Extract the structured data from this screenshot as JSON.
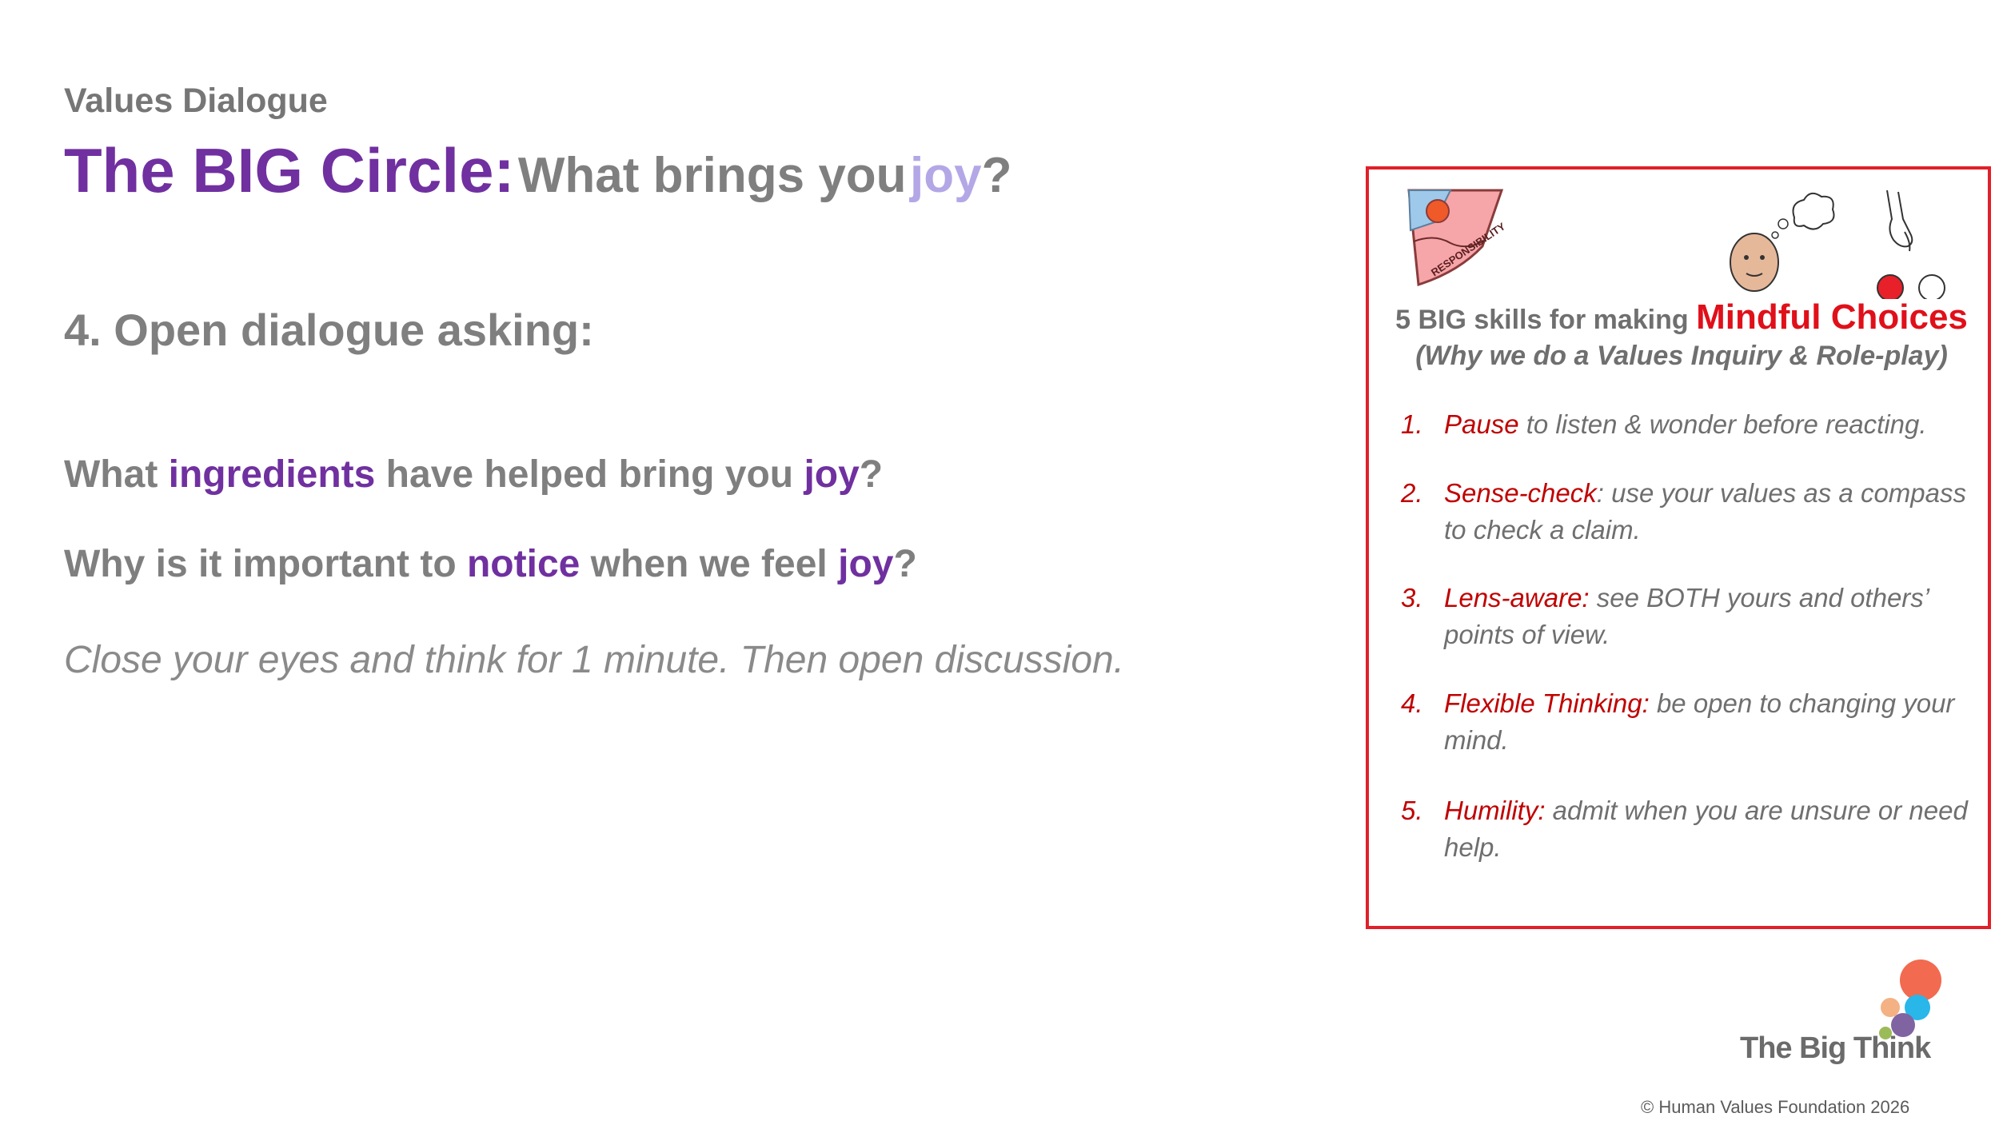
{
  "header": {
    "kicker": "Values Dialogue",
    "title_main": "The BIG Circle:",
    "title_sub": "What brings you",
    "title_joy": "joy",
    "title_q": "?"
  },
  "main": {
    "step": "4. Open dialogue asking:",
    "question1": {
      "a": "What ",
      "b": "ingredients",
      "c": " have helped bring you ",
      "d": "joy",
      "e": "?"
    },
    "question2": {
      "a": "Why is it important to ",
      "b": "notice",
      "c": " when we feel ",
      "d": "joy",
      "e": "?"
    },
    "instruction": "Close your eyes and think for 1 minute. Then open discussion."
  },
  "panel": {
    "heading_a": "5 BIG skills for making ",
    "heading_b": "Mindful Choices",
    "subheading": "(Why we do a Values Inquiry & Role-play)",
    "badge_text": "RESPONSIBILITY",
    "skills": [
      {
        "num": "1.",
        "key": "Pause",
        "text": " to listen & wonder before reacting."
      },
      {
        "num": "2.",
        "key": "Sense-check",
        "text": ": use your values as a compass to check a claim."
      },
      {
        "num": "3.",
        "key": "Lens-aware:",
        "text": " see BOTH yours and others’ points of view."
      },
      {
        "num": "4.",
        "key": "Flexible Thinking:",
        "text": " be open to changing your mind."
      },
      {
        "num": "5.",
        "key": "Humility:",
        "text": " admit when you are unsure or need help."
      }
    ]
  },
  "footer": {
    "brand": "The Big Think",
    "copyright": "© Human Values Foundation 2026"
  },
  "colors": {
    "purple": "#7030a0",
    "lavender": "#b4a7e6",
    "red": "#e0101a",
    "grey": "#7f7f7f"
  }
}
